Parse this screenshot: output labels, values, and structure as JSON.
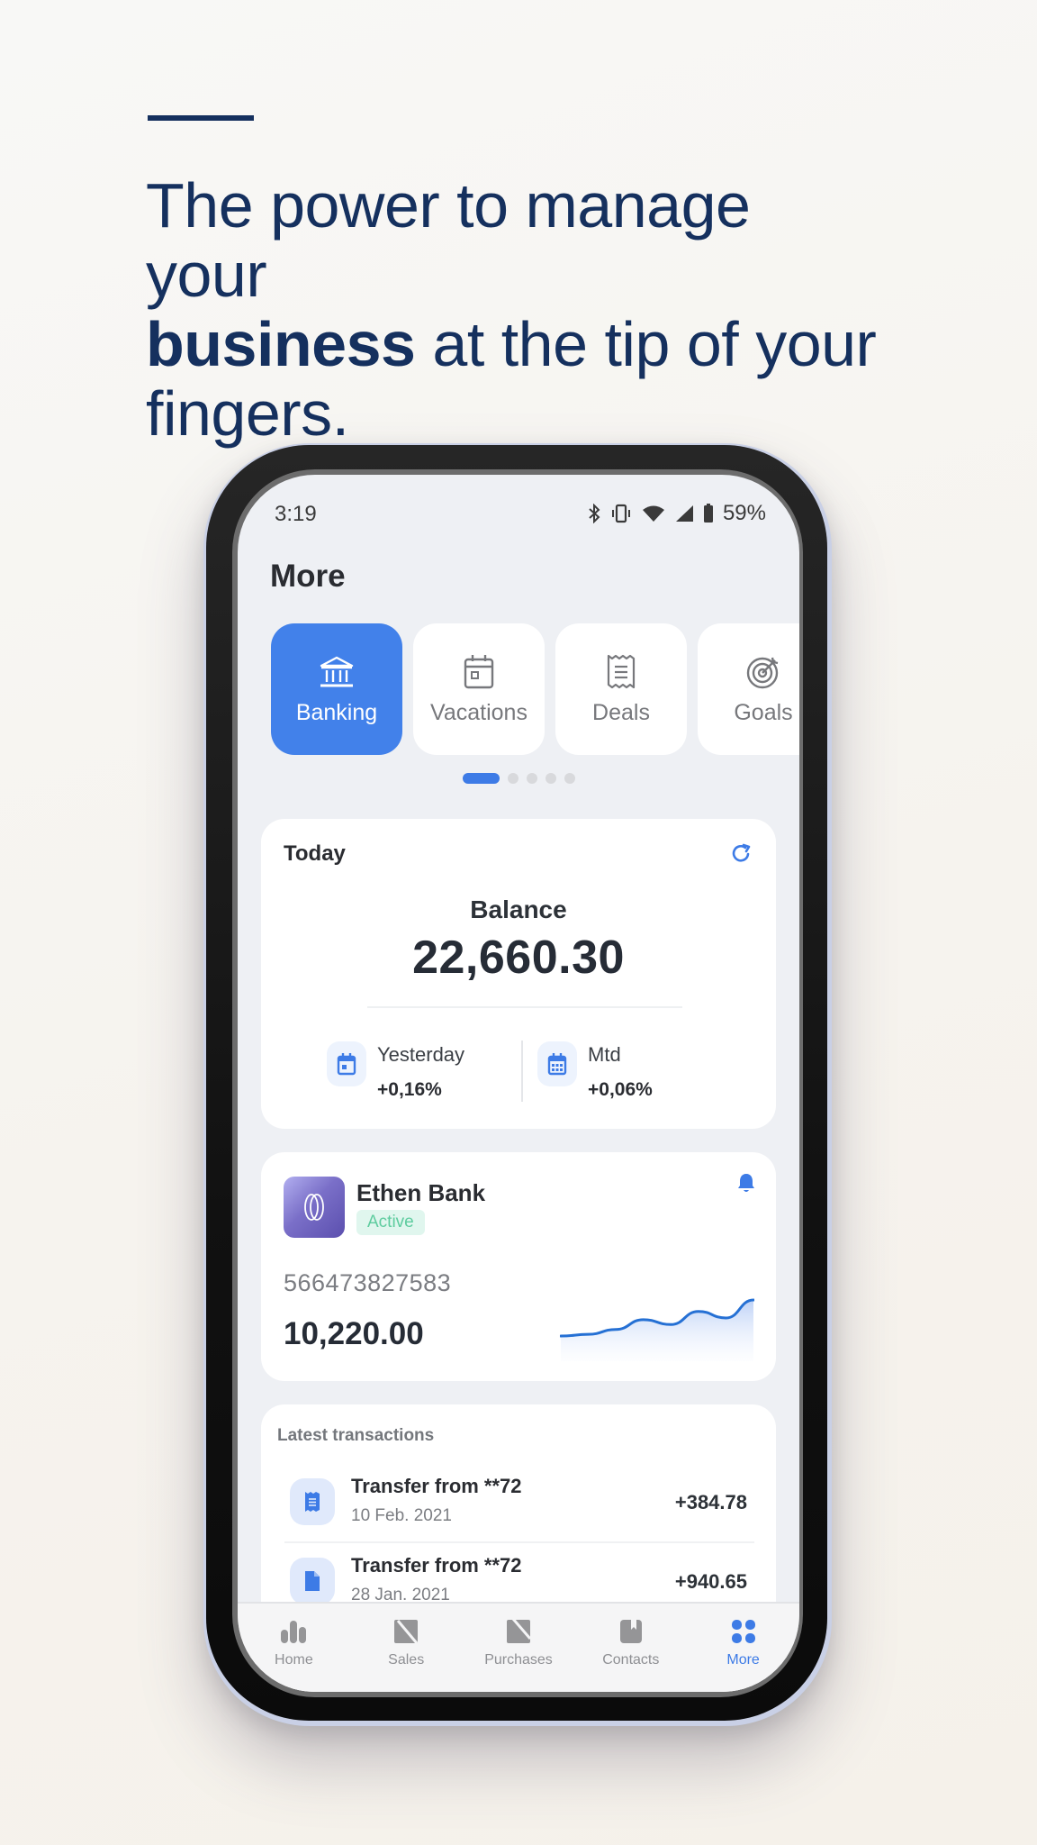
{
  "hero": {
    "line1": "The power to manage your",
    "bold": "business",
    "line2_rest": " at the tip of your",
    "line3": "fingers."
  },
  "status_bar": {
    "time": "3:19",
    "battery": "59%",
    "icons": [
      "bluetooth-icon",
      "vibrate-icon",
      "wifi-icon",
      "signal-icon",
      "battery-icon"
    ]
  },
  "page": {
    "title": "More"
  },
  "categories": {
    "items": [
      {
        "label": "Banking",
        "icon": "bank-icon",
        "active": true
      },
      {
        "label": "Vacations",
        "icon": "calendar-icon",
        "active": false
      },
      {
        "label": "Deals",
        "icon": "receipt-icon",
        "active": false
      },
      {
        "label": "Goals",
        "icon": "target-icon",
        "active": false
      }
    ],
    "pager": {
      "pages": 5,
      "current": 1
    }
  },
  "today": {
    "title": "Today",
    "balance_label": "Balance",
    "balance_value": "22,660.30",
    "stats": [
      {
        "label": "Yesterday",
        "value": "+0,16%",
        "icon": "calendar-day-icon"
      },
      {
        "label": "Mtd",
        "value": "+0,06%",
        "icon": "calendar-month-icon"
      }
    ]
  },
  "bank_account": {
    "name": "Ethen Bank",
    "status": "Active",
    "account_number": "566473827583",
    "amount": "10,220.00",
    "trend": [
      2,
      3,
      6,
      12,
      9,
      17,
      13,
      24
    ]
  },
  "transactions": {
    "title": "Latest transactions",
    "items": [
      {
        "name": "Transfer from **72",
        "date": "10 Feb. 2021",
        "amount": "+384.78",
        "icon": "receipt-icon"
      },
      {
        "name": "Transfer from **72",
        "date": "28 Jan. 2021",
        "amount": "+940.65",
        "icon": "document-icon"
      }
    ]
  },
  "bottom_nav": {
    "items": [
      {
        "label": "Home",
        "icon": "bar-chart-icon",
        "active": false
      },
      {
        "label": "Sales",
        "icon": "sales-icon",
        "active": false
      },
      {
        "label": "Purchases",
        "icon": "purchases-icon",
        "active": false
      },
      {
        "label": "Contacts",
        "icon": "contacts-book-icon",
        "active": false
      },
      {
        "label": "More",
        "icon": "grid-icon",
        "active": true
      }
    ]
  },
  "colors": {
    "brand_navy": "#15305e",
    "accent_blue": "#4281ea",
    "active_green": "#5ecc9f"
  }
}
